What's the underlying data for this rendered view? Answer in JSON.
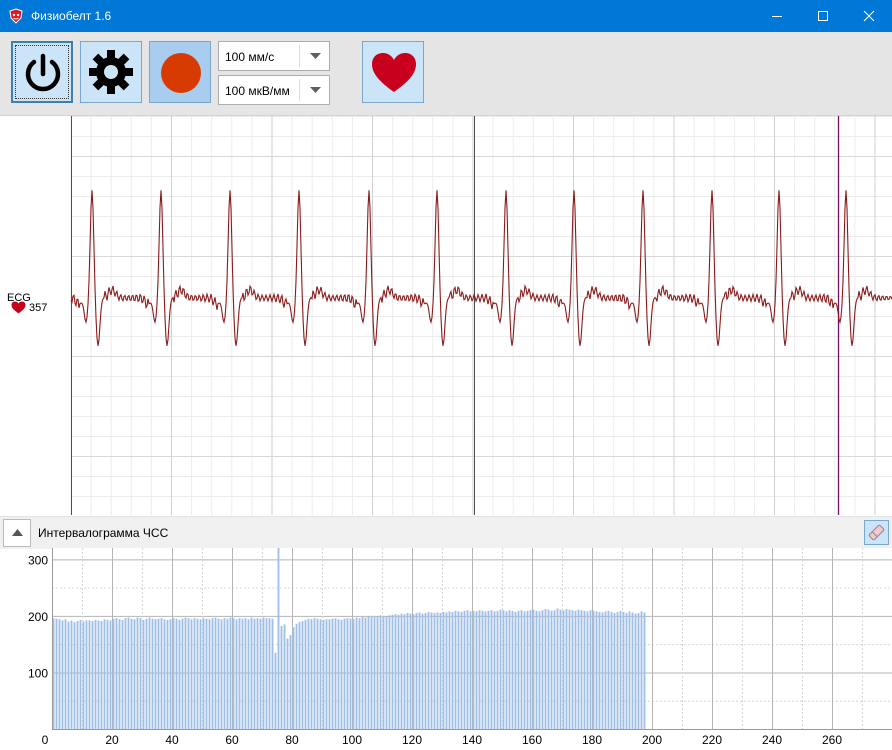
{
  "window": {
    "title": "Физиобелт 1.6",
    "controls": [
      "minimize",
      "maximize",
      "close"
    ]
  },
  "toolbar": {
    "buttons": [
      {
        "name": "power",
        "icon": "power-icon",
        "active": true
      },
      {
        "name": "settings",
        "icon": "gear-icon"
      },
      {
        "name": "record",
        "icon": "record-icon",
        "color": "#d83b01"
      },
      {
        "name": "heart-rate",
        "icon": "heart-icon",
        "color": "#c8001e"
      }
    ],
    "sweep_speed": {
      "selected": "100 мм/с"
    },
    "amplitude": {
      "selected": "100 мкВ/мм"
    }
  },
  "ecg": {
    "channel_label": "ECG",
    "heart_value": "357",
    "trace_color": "#8b1a1a",
    "cursor_color": "#7a1060"
  },
  "interval_panel": {
    "title": "Интервалограмма ЧСС",
    "bar_color": "#9fbfe6"
  },
  "chart_data": {
    "type": "bar",
    "x_ticks": [
      0,
      20,
      40,
      60,
      80,
      100,
      120,
      140,
      160,
      180,
      200,
      220,
      240,
      260
    ],
    "y_ticks": [
      100,
      200,
      300
    ],
    "xlim": [
      0,
      280
    ],
    "ylim": [
      0,
      320
    ],
    "values": [
      196,
      195,
      194,
      192,
      194,
      190,
      192,
      189,
      191,
      193,
      190,
      192,
      192,
      191,
      193,
      192,
      191,
      194,
      193,
      192,
      195,
      196,
      194,
      193,
      196,
      197,
      195,
      194,
      197,
      196,
      193,
      195,
      197,
      195,
      194,
      195,
      196,
      194,
      193,
      194,
      196,
      195,
      193,
      195,
      197,
      196,
      194,
      196,
      195,
      194,
      196,
      195,
      194,
      196,
      197,
      195,
      194,
      196,
      195,
      197,
      196,
      194,
      196,
      195,
      196,
      194,
      197,
      195,
      196,
      195,
      197,
      196,
      196,
      195,
      135,
      320,
      182,
      185,
      160,
      166,
      180,
      186,
      189,
      191,
      193,
      195,
      194,
      196,
      195,
      194,
      193,
      194,
      194,
      195,
      196,
      194,
      193,
      195,
      196,
      195,
      195,
      197,
      196,
      198,
      197,
      199,
      198,
      200,
      199,
      201,
      200,
      199,
      201,
      202,
      203,
      202,
      204,
      203,
      205,
      204,
      203,
      205,
      206,
      204,
      205,
      207,
      206,
      205,
      206,
      205,
      207,
      206,
      208,
      207,
      209,
      208,
      207,
      209,
      210,
      208,
      209,
      208,
      210,
      209,
      208,
      209,
      210,
      208,
      209,
      211,
      210,
      208,
      210,
      209,
      207,
      209,
      210,
      208,
      209,
      210,
      211,
      209,
      208,
      210,
      212,
      211,
      209,
      210,
      213,
      211,
      210,
      212,
      211,
      210,
      209,
      211,
      210,
      209,
      208,
      210,
      209,
      208,
      207,
      206,
      208,
      209,
      207,
      205,
      207,
      209,
      207,
      205,
      208,
      206,
      204,
      205,
      208,
      206
    ]
  }
}
